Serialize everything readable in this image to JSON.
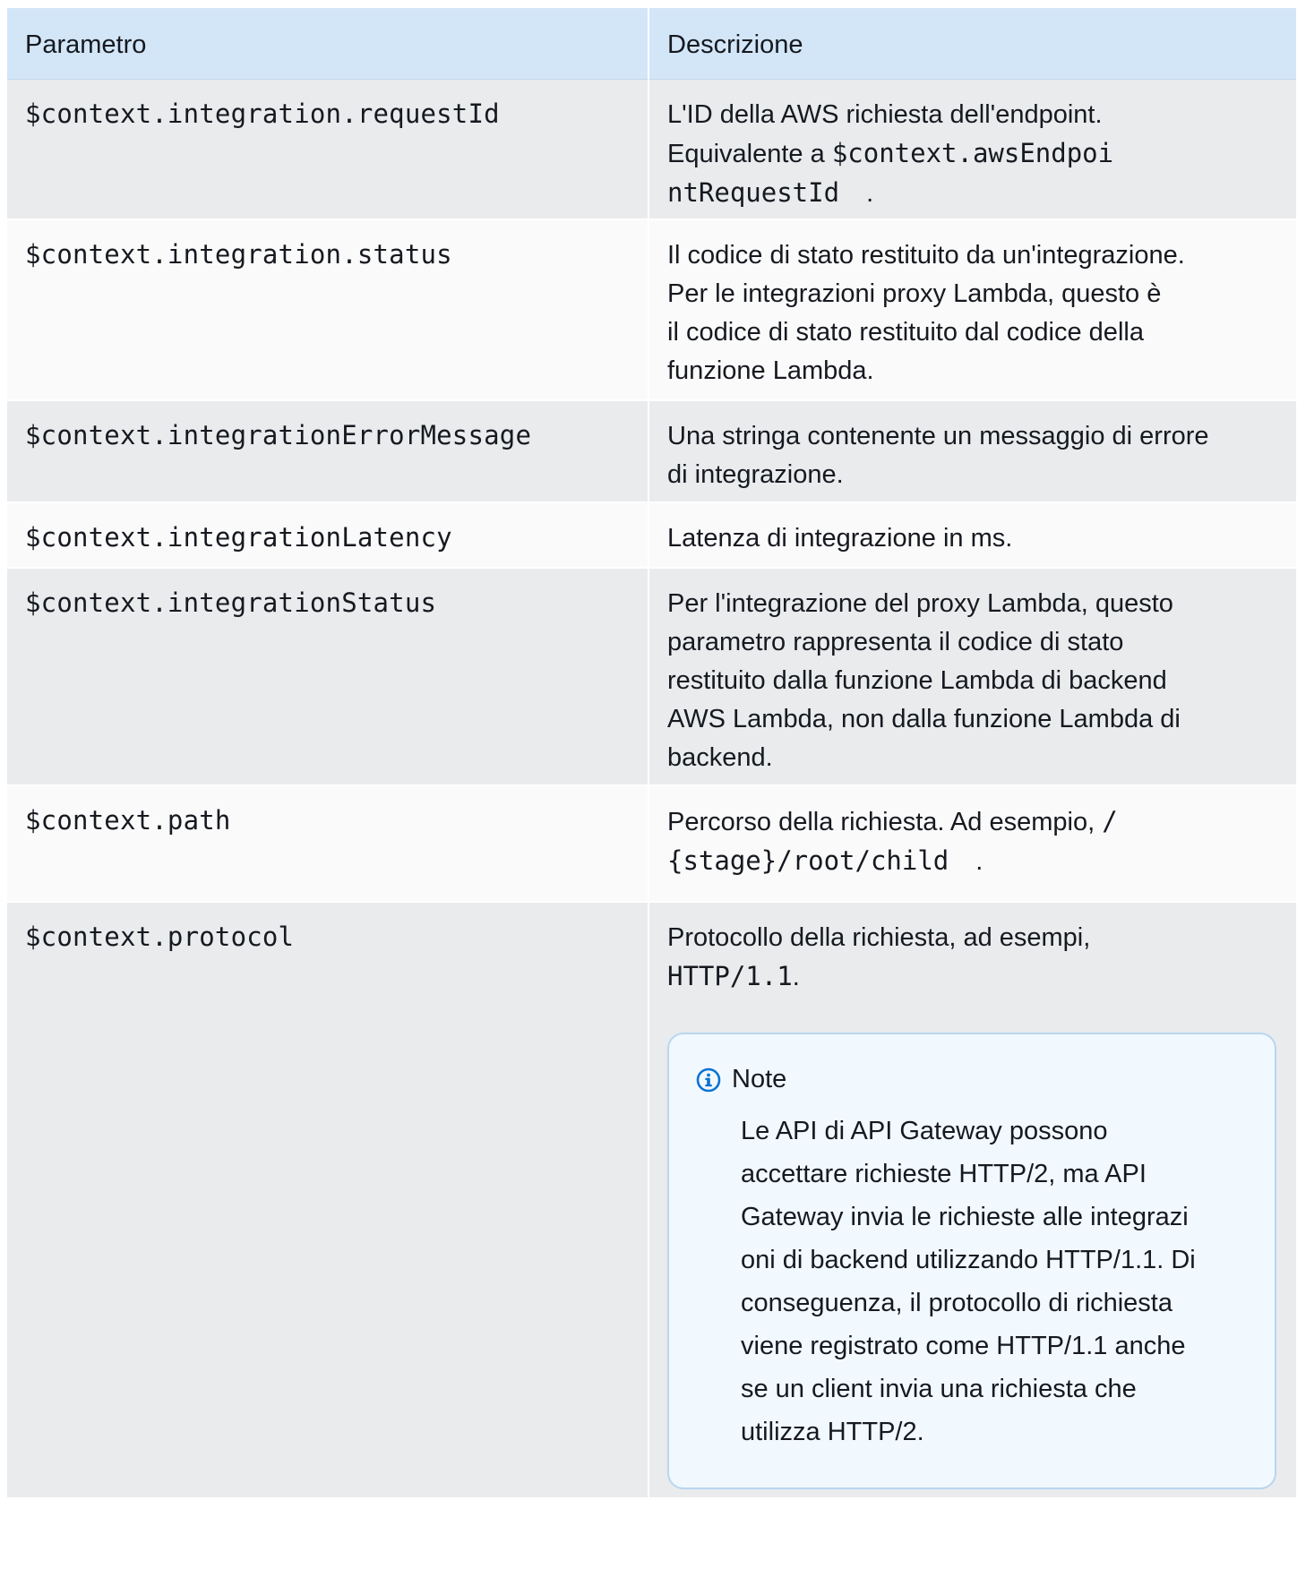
{
  "table": {
    "headers": {
      "param": "Parametro",
      "desc": "Descrizione"
    },
    "rows": [
      {
        "param": "$context.integration.requestId",
        "desc_pre": "L'ID della AWS richiesta dell'endpoint.",
        "desc_pre2": "Equivalente a",
        "desc_code_line1": "$context.awsEndpoi",
        "desc_code_line2": "ntRequestId",
        "desc_post": "."
      },
      {
        "param": "$context.integration.status",
        "desc_lines": [
          "Il codice di stato restituito da un'integrazione.",
          "Per le integrazioni proxy Lambda, questo è",
          "il codice di stato restituito dal codice della",
          "funzione Lambda."
        ]
      },
      {
        "param": "$context.integrationErrorMessage",
        "desc_lines": [
          "Una stringa contenente un messaggio di errore",
          "di integrazione."
        ]
      },
      {
        "param": "$context.integrationLatency",
        "desc_lines": [
          "Latenza di integrazione in ms."
        ]
      },
      {
        "param": "$context.integrationStatus",
        "desc_lines": [
          "Per l'integrazione del proxy Lambda, questo",
          "parametro rappresenta il codice di stato",
          "restituito dalla funzione Lambda di backend",
          "AWS Lambda, non dalla funzione Lambda di",
          "backend."
        ]
      },
      {
        "param": "$context.path",
        "desc_pre": "Percorso della richiesta. Ad esempio,",
        "desc_code_line1": "/",
        "desc_code_line2": "{stage}/root/child",
        "desc_post": "."
      },
      {
        "param": "$context.protocol",
        "desc_pre": "Protocollo della richiesta, ad esempi,",
        "desc_code": "HTTP/1.1",
        "desc_post": ".",
        "note": {
          "title": "Note",
          "icon": "info-icon",
          "lines": [
            "Le API di API Gateway possono",
            "accettare richieste HTTP/2, ma API",
            "Gateway invia le richieste alle integrazi",
            "oni di backend utilizzando HTTP/1.1. Di",
            "conseguenza, il protocollo di richiesta",
            "viene registrato come HTTP/1.1 anche",
            "se un client invia una richiesta che",
            "utilizza HTTP/2."
          ]
        }
      }
    ]
  },
  "colors": {
    "header_bg": "#d3e6f8",
    "row_shaded": "#e9ebed",
    "row_light": "#fafafa",
    "note_bg": "#f1f8fe",
    "note_border": "#b8d6f0",
    "info_blue": "#0972d3"
  }
}
